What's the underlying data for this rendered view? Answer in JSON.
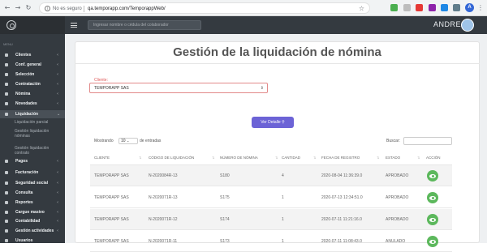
{
  "browser": {
    "not_secure": "No es seguro",
    "url": "qa.temporapp.com/TemporappWeb/",
    "profile_letter": "A"
  },
  "topbar": {
    "search_placeholder": "Ingresar nombre o cédula del colaborador",
    "username": "ANDRES"
  },
  "sidebar": {
    "header": "MENU",
    "items": [
      {
        "label": "Clientes",
        "chev": "‹"
      },
      {
        "label": "Conf. general",
        "chev": "‹"
      },
      {
        "label": "Selección",
        "chev": "‹"
      },
      {
        "label": "Contratación",
        "chev": "‹"
      },
      {
        "label": "Nómina",
        "chev": "‹"
      },
      {
        "label": "Novedades",
        "chev": "‹"
      },
      {
        "label": "Liquidación",
        "chev": "⌄"
      },
      {
        "label": "Pagos",
        "chev": "‹"
      },
      {
        "label": "Facturación",
        "chev": "‹"
      },
      {
        "label": "Seguridad social",
        "chev": "‹"
      },
      {
        "label": "Consulta",
        "chev": "‹"
      },
      {
        "label": "Reportes",
        "chev": "‹"
      },
      {
        "label": "Cargue masivo",
        "chev": "‹"
      },
      {
        "label": "Contabilidad",
        "chev": "‹"
      },
      {
        "label": "Gestión actividades",
        "chev": "‹"
      },
      {
        "label": "Usuarios",
        "chev": ""
      }
    ],
    "subitems": [
      "Liquidación parcial",
      "Gestión liquidación nóminas",
      "Gestión liquidación contrato"
    ]
  },
  "main": {
    "title": "Gestión de la liquidación de nómina",
    "client_label": "Cliente:",
    "client_value": "TEMPORAPP SAS",
    "detail_button": "Ver Detalle",
    "show_label": "Mostrando",
    "page_length": "10",
    "entries_label": "de entradas",
    "search_label": "Buscar:"
  },
  "table": {
    "columns": [
      "CLIENTE",
      "CÓDIGO DE LIQUIDACIÓN",
      "NÚMERO DE NÓMINA",
      "CANTIDAD",
      "FECHA DE REGISTRO",
      "ESTADO",
      "ACCIÓN"
    ],
    "rows": [
      [
        "TEMPORAPP SAS",
        "N-2020084R-13",
        "S180",
        "4",
        "2020-08-04 11:36:39.0",
        "APROBADO"
      ],
      [
        "TEMPORAPP SAS",
        "N-2020071R-13",
        "S175",
        "1",
        "2020-07-13 12:34:51.0",
        "APROBADO"
      ],
      [
        "TEMPORAPP SAS",
        "N-2020071R-12",
        "S174",
        "1",
        "2020-07-11 11:21:16.0",
        "APROBADO"
      ],
      [
        "TEMPORAPP SAS",
        "N-2020071R-11",
        "S173",
        "1",
        "2020-07-11 11:08:43.0",
        "ANULADO"
      ]
    ]
  }
}
